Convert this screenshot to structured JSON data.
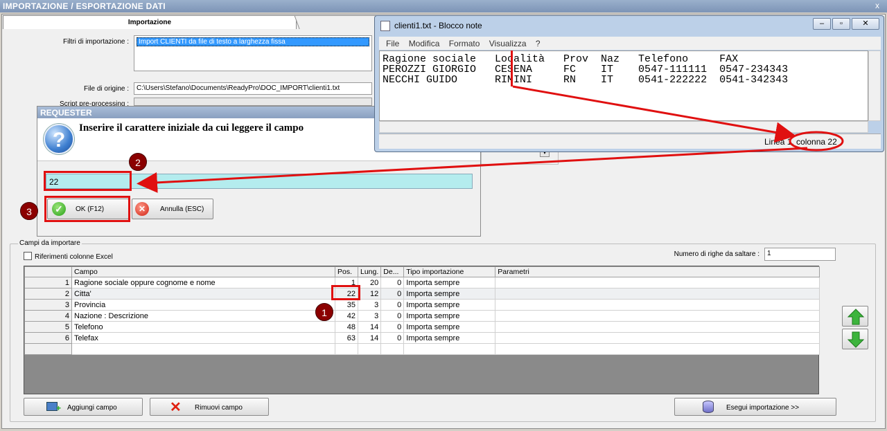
{
  "window": {
    "title": "IMPORTAZIONE / ESPORTAZIONE DATI",
    "close_glyph": "x"
  },
  "tabs": [
    {
      "label": "Importazione"
    },
    {
      "label": ""
    }
  ],
  "form": {
    "filters_label": "Filtri di importazione :",
    "filters_selected": "Import CLIENTI da file di testo a larghezza fissa",
    "source_label": "File di origine :",
    "source_value": "C:\\Users\\Stefano\\Documents\\ReadyPro\\DOC_IMPORT\\clienti1.txt",
    "script_label": "Script pre-processing :"
  },
  "requester": {
    "title": "REQUESTER",
    "prompt": "Inserire il carattere iniziale da cui leggere il campo",
    "input_value": "22",
    "ok_label": "OK (F12)",
    "cancel_label": "Annulla (ESC)"
  },
  "notepad": {
    "title": "clienti1.txt - Blocco note",
    "menu": [
      "File",
      "Modifica",
      "Formato",
      "Visualizza",
      "?"
    ],
    "lines": [
      "Ragione sociale   Località   Prov  Naz   Telefono     FAX",
      "PEROZZI GIORGIO   CESENA     FC    IT    0547-111111  0547-234343",
      "NECCHI GUIDO      RIMINI     RN    IT    0541-222222  0541-342343"
    ],
    "status": "Linea 1, colonna 22"
  },
  "fields_section": {
    "title": "Campi da importare",
    "excel_refs_label": "Riferimenti colonne Excel",
    "skip_rows_label": "Numero di righe da saltare :",
    "skip_rows_value": "1",
    "columns": [
      "",
      "Campo",
      "Pos.",
      "Lung.",
      "De...",
      "Tipo importazione",
      "Parametri"
    ],
    "rows": [
      {
        "n": "1",
        "campo": "Ragione sociale oppure cognome e nome",
        "pos": "1",
        "lung": "20",
        "dec": "0",
        "tipo": "Importa sempre"
      },
      {
        "n": "2",
        "campo": "Citta'",
        "pos": "22",
        "lung": "12",
        "dec": "0",
        "tipo": "Importa sempre"
      },
      {
        "n": "3",
        "campo": "Provincia",
        "pos": "35",
        "lung": "3",
        "dec": "0",
        "tipo": "Importa sempre"
      },
      {
        "n": "4",
        "campo": "Nazione : Descrizione",
        "pos": "42",
        "lung": "3",
        "dec": "0",
        "tipo": "Importa sempre"
      },
      {
        "n": "5",
        "campo": "Telefono",
        "pos": "48",
        "lung": "14",
        "dec": "0",
        "tipo": "Importa sempre"
      },
      {
        "n": "6",
        "campo": "Telefax",
        "pos": "63",
        "lung": "14",
        "dec": "0",
        "tipo": "Importa sempre"
      }
    ],
    "add_label": "Aggiungi campo",
    "remove_label": "Rimuovi campo",
    "run_label": "Esegui importazione >>"
  },
  "callouts": [
    "1",
    "2",
    "3"
  ],
  "colors": {
    "callout_box": "#e01010",
    "callout_badge": "#8b0000",
    "input_bg": "#b4ecee"
  }
}
